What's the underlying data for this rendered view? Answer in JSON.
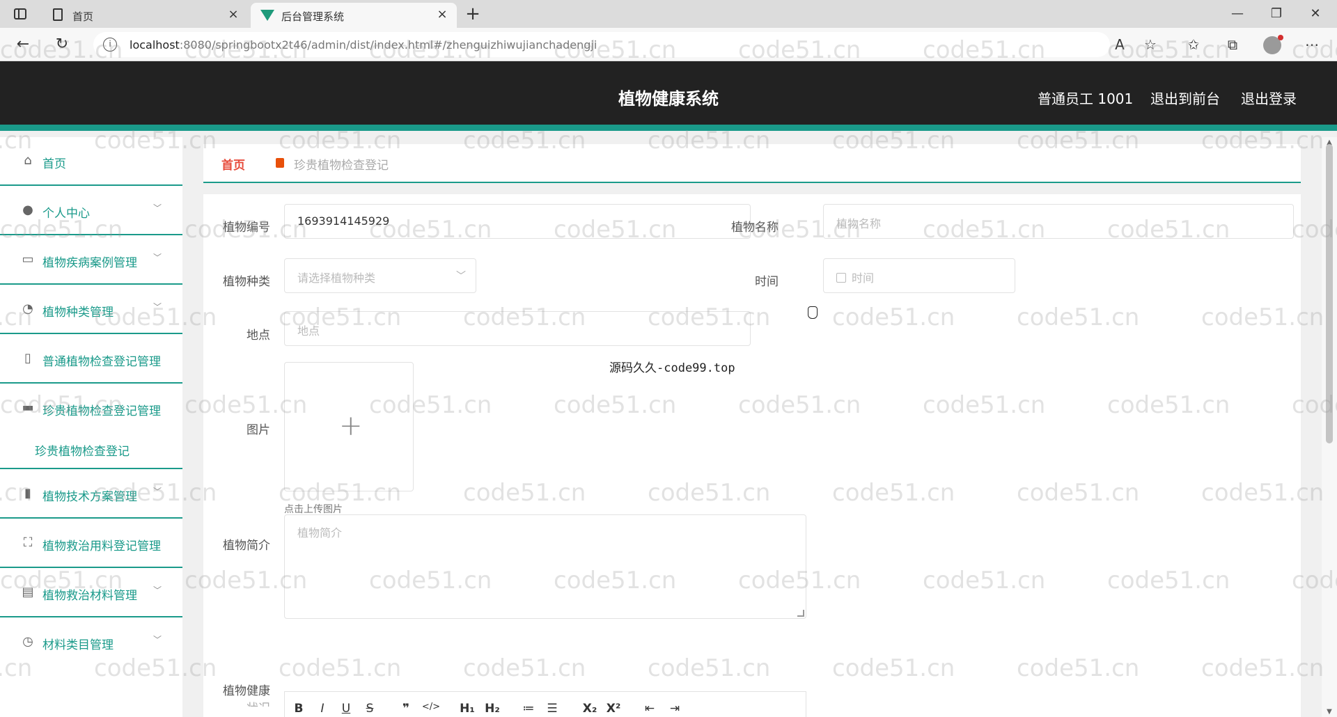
{
  "browser": {
    "tabs": [
      {
        "label": "首页",
        "icon": "document-icon"
      },
      {
        "label": "后台管理系统",
        "icon": "vue-logo-icon"
      }
    ],
    "url_host": "localhost",
    "url_rest": ":8080/springbootx2t46/admin/dist/index.html#/zhenguizhiwujianchadengji",
    "minimize": "—",
    "maximize": "❐",
    "close": "✕",
    "new_tab": "+",
    "close_tab": "×"
  },
  "header": {
    "title": "植物健康系统",
    "user": "普通员工 1001",
    "to_front": "退出到前台",
    "logout": "退出登录"
  },
  "sidebar": {
    "items": [
      {
        "label": "首页",
        "icon": "home-icon",
        "expandable": false
      },
      {
        "label": "个人中心",
        "icon": "user-icon",
        "expandable": true
      },
      {
        "label": "植物疾病案例管理",
        "icon": "message-icon",
        "expandable": true
      },
      {
        "label": "植物种类管理",
        "icon": "clock-icon",
        "expandable": true
      },
      {
        "label": "普通植物检查登记管理",
        "icon": "mic-icon",
        "expandable": false
      },
      {
        "label": "珍贵植物检查登记管理",
        "icon": "folder-icon",
        "expandable": false
      },
      {
        "label": "植物技术方案管理",
        "icon": "bar-chart-icon",
        "expandable": true
      },
      {
        "label": "植物救治用料登记管理",
        "icon": "scan-icon",
        "expandable": false
      },
      {
        "label": "植物救治材料管理",
        "icon": "briefcase-icon",
        "expandable": true
      },
      {
        "label": "材料类目管理",
        "icon": "compass-icon",
        "expandable": true
      }
    ],
    "sub_item": "珍贵植物检查登记"
  },
  "breadcrumb": {
    "home": "首页",
    "current": "珍贵植物检查登记"
  },
  "form": {
    "plant_no_label": "植物编号",
    "plant_no_value": "1693914145929",
    "plant_name_label": "植物名称",
    "plant_name_placeholder": "植物名称",
    "plant_type_label": "植物种类",
    "plant_type_placeholder": "请选择植物种类",
    "time_label": "时间",
    "time_placeholder": "时间",
    "location_label": "地点",
    "location_placeholder": "地点",
    "image_label": "图片",
    "upload_hint": "点击上传图片",
    "intro_label": "植物简介",
    "intro_placeholder": "植物简介",
    "health_label": "植物健康",
    "health_label_cont": "状况"
  },
  "editor_toolbar": [
    "B",
    "I",
    "U",
    "S",
    "❞",
    "</>",
    "H₁",
    "H₂",
    "≔",
    "☰",
    "X₂",
    "X²",
    "⇤",
    "⇥"
  ],
  "center_note": "源码久久-code99.top",
  "watermark": "code51.cn"
}
